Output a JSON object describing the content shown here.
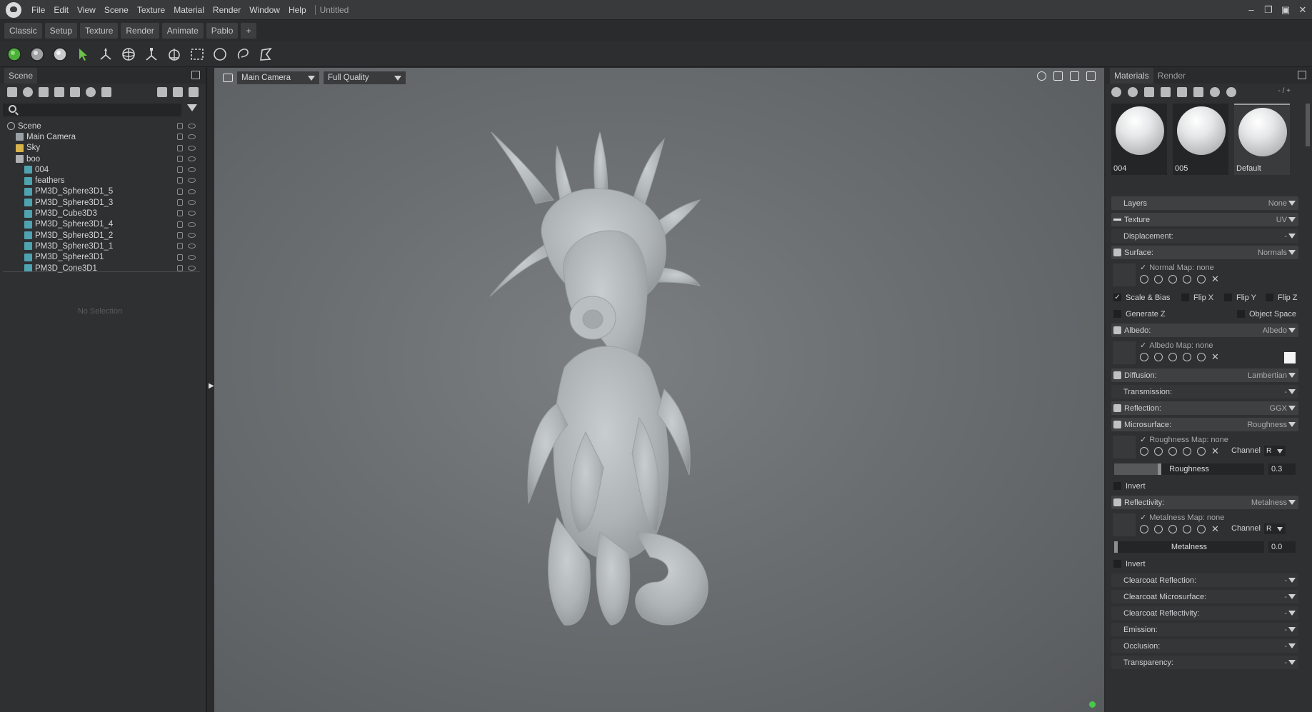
{
  "menubar": {
    "items": [
      "File",
      "Edit",
      "View",
      "Scene",
      "Texture",
      "Material",
      "Render",
      "Window",
      "Help"
    ],
    "doc_title": "Untitled"
  },
  "workspace_tabs": [
    "Classic",
    "Setup",
    "Texture",
    "Render",
    "Animate",
    "Pablo",
    "+"
  ],
  "scene_panel": {
    "tab": "Scene",
    "tree": [
      {
        "label": "Scene",
        "depth": 0,
        "icon": "scene"
      },
      {
        "label": "Main Camera",
        "depth": 1,
        "icon": "cam"
      },
      {
        "label": "Sky",
        "depth": 1,
        "icon": "sky"
      },
      {
        "label": "boo",
        "depth": 1,
        "icon": "grp"
      },
      {
        "label": "004",
        "depth": 2,
        "icon": "mesh"
      },
      {
        "label": "feathers",
        "depth": 2,
        "icon": "mesh"
      },
      {
        "label": "PM3D_Sphere3D1_5",
        "depth": 2,
        "icon": "mesh"
      },
      {
        "label": "PM3D_Sphere3D1_3",
        "depth": 2,
        "icon": "mesh"
      },
      {
        "label": "PM3D_Cube3D3",
        "depth": 2,
        "icon": "mesh"
      },
      {
        "label": "PM3D_Sphere3D1_4",
        "depth": 2,
        "icon": "mesh"
      },
      {
        "label": "PM3D_Sphere3D1_2",
        "depth": 2,
        "icon": "mesh"
      },
      {
        "label": "PM3D_Sphere3D1_1",
        "depth": 2,
        "icon": "mesh"
      },
      {
        "label": "PM3D_Sphere3D1",
        "depth": 2,
        "icon": "mesh"
      },
      {
        "label": "PM3D_Cone3D1",
        "depth": 2,
        "icon": "mesh"
      }
    ],
    "no_selection": "No Selection"
  },
  "viewport": {
    "camera": "Main Camera",
    "quality": "Full Quality"
  },
  "right_panel": {
    "tabs": [
      "Materials",
      "Render"
    ],
    "counter": "- / +",
    "materials": [
      "004",
      "005",
      "Default"
    ],
    "sections": {
      "layers": {
        "label": "Layers",
        "value": "None"
      },
      "texture": {
        "label": "Texture",
        "value": "UV"
      },
      "displacement": {
        "label": "Displacement:",
        "value": "-"
      },
      "surface": {
        "label": "Surface:",
        "value": "Normals"
      },
      "normal_map": "Normal Map: none",
      "scale_bias": "Scale & Bias",
      "flip_x": "Flip X",
      "flip_y": "Flip Y",
      "flip_z": "Flip Z",
      "generate_z": "Generate Z",
      "object_space": "Object Space",
      "albedo": {
        "label": "Albedo:",
        "value": "Albedo"
      },
      "albedo_map": "Albedo Map: none",
      "diffusion": {
        "label": "Diffusion:",
        "value": "Lambertian"
      },
      "transmission": {
        "label": "Transmission:",
        "value": "-"
      },
      "reflection": {
        "label": "Reflection:",
        "value": "GGX"
      },
      "microsurface": {
        "label": "Microsurface:",
        "value": "Roughness"
      },
      "roughness_map": "Roughness Map: none",
      "channel_label": "Channel",
      "roughness_channel": "R",
      "roughness": {
        "label": "Roughness",
        "value": "0.3"
      },
      "invert": "Invert",
      "reflectivity": {
        "label": "Reflectivity:",
        "value": "Metalness"
      },
      "metalness_map": "Metalness Map: none",
      "metalness_channel": "R",
      "metalness": {
        "label": "Metalness",
        "value": "0.0"
      },
      "clearcoat_reflection": {
        "label": "Clearcoat Reflection:",
        "value": "-"
      },
      "clearcoat_microsurface": {
        "label": "Clearcoat Microsurface:",
        "value": "-"
      },
      "clearcoat_reflectivity": {
        "label": "Clearcoat Reflectivity:",
        "value": "-"
      },
      "emission": {
        "label": "Emission:",
        "value": "-"
      },
      "occlusion": {
        "label": "Occlusion:",
        "value": "-"
      },
      "transparency": {
        "label": "Transparency:",
        "value": "-"
      }
    },
    "roughness_level": 0.3,
    "metalness_level": 0.0
  },
  "colors": {
    "status_dot": "#49c74d",
    "accent_green": "#4caf3a"
  }
}
